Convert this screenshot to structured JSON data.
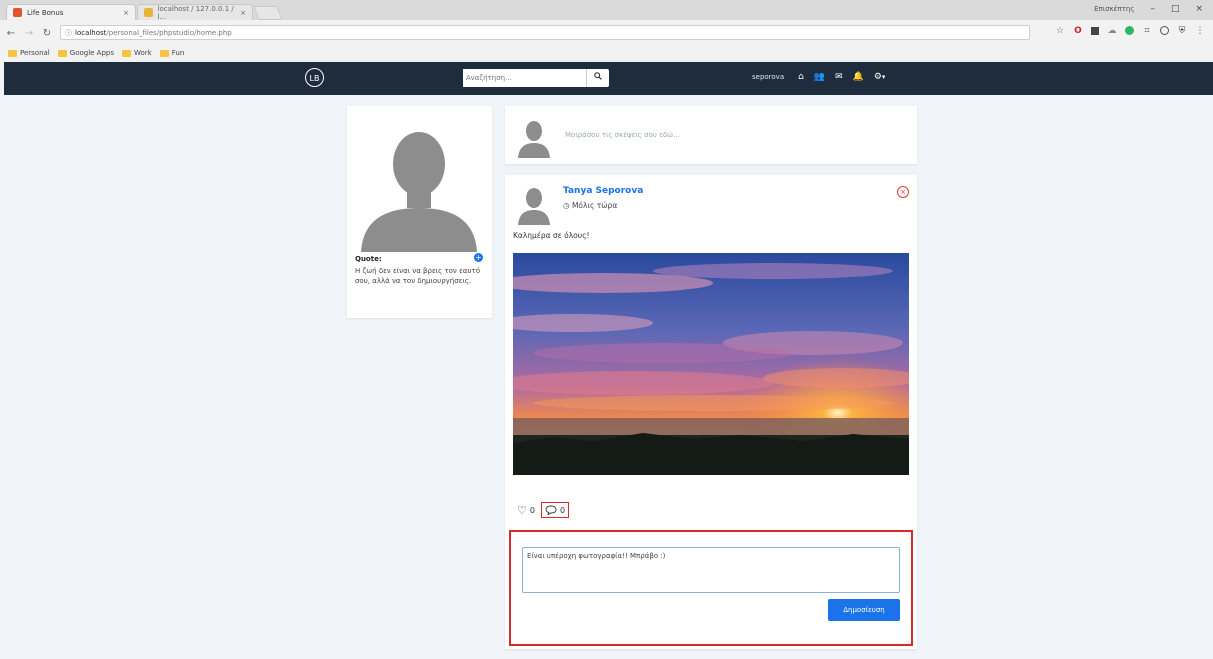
{
  "browser": {
    "tabs": [
      {
        "title": "Life Bonus",
        "close": "×"
      },
      {
        "title": "localhost / 127.0.0.1 / l...",
        "close": "×"
      }
    ],
    "window_user": "Επισκέπτης",
    "window_controls": {
      "minimize": "–",
      "maximize": "□",
      "close": "×"
    },
    "url_host": "localhost",
    "url_path": "/personal_files/phpstudio/home.php",
    "bookmarks": [
      "Personal",
      "Google Apps",
      "Work",
      "Fun"
    ]
  },
  "navbar": {
    "logo": "LB",
    "search_placeholder": "Αναζήτηση...",
    "search_icon": "search-icon",
    "username": "seporova",
    "icons": [
      "home-icon",
      "users-icon",
      "envelope-icon",
      "bell-icon",
      "gear-icon"
    ],
    "caret": "▾"
  },
  "profile": {
    "quote_title": "Quote:",
    "quote_text": "Η ζωή δεν είναι να βρεις τον εαυτό σου, αλλά να τον δημιουργήσεις."
  },
  "composer": {
    "placeholder": "Μοιράσου τις σκέψεις σου εδώ..."
  },
  "post": {
    "author": "Tanya Seporova",
    "time": "Μόλις τώρα",
    "text": "Καλημέρα σε όλους!",
    "likes": "0",
    "comments": "0",
    "comment_value": "Είναι υπέροχη φωτογραφία!! Μπράβο :)",
    "publish_label": "Δημοσίευση"
  },
  "colors": {
    "navbar": "#1f2c3d",
    "accent": "#1a73e8",
    "highlight": "#d62b2b",
    "background": "#f0f4f8"
  }
}
